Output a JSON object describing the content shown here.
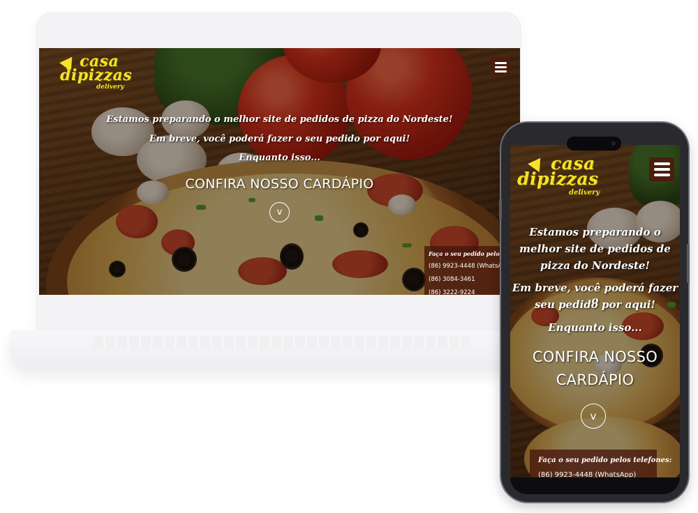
{
  "brand": {
    "line1": "casa",
    "line2": "dipizzas",
    "line3": "delivery",
    "primary_color": "#f5e326",
    "dark_color": "#4a1e0e"
  },
  "hero": {
    "line1": "Estamos preparando o melhor site de pedidos de pizza do Nordeste!",
    "line2": "Em breve, você poderá fazer o seu pedido por aqui!",
    "line3": "Enquanto isso...",
    "cta": "CONFIRA NOSSO CARDÁPIO",
    "scroll_icon": "chevron-down-icon",
    "scroll_glyph": "v"
  },
  "phones_box": {
    "title": "Faça o seu pedido pelos telefones:",
    "numbers": [
      "(86) 9923-4448 (WhatsApp)",
      "(86) 3084-3461",
      "(86) 3222-9224"
    ]
  },
  "menu": {
    "icon": "hamburger-menu-icon"
  },
  "mobile": {
    "tag1": "Estamos preparando o",
    "tag2": "melhor site de pedidos de",
    "tag3": "pizza do Nordeste!",
    "tag4": "Em breve, você poderá fazer o",
    "tag5": "seu pedido por aqui!",
    "tag6": "Enquanto isso...",
    "cta1": "CONFIRA NOSSO",
    "cta2": "CARDÁPIO"
  }
}
